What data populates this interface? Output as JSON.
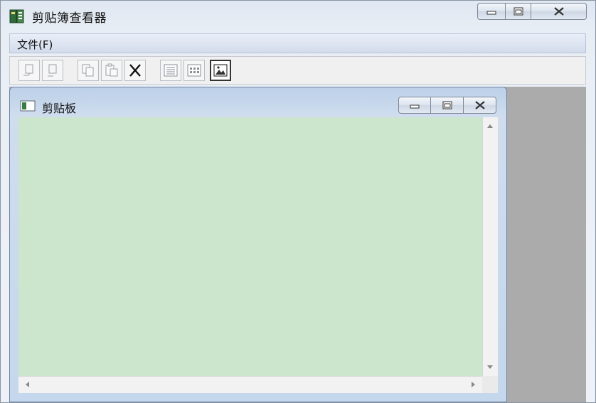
{
  "window": {
    "title": "剪贴簿查看器",
    "icons": {
      "app": "clipbook-icon",
      "minimize": "minimize-icon",
      "maximize": "restore-icon",
      "close": "close-icon"
    }
  },
  "menu": {
    "items": [
      {
        "label": "文件(F)"
      }
    ]
  },
  "toolbar": {
    "buttons": [
      {
        "icon": "share-icon",
        "enabled": false
      },
      {
        "icon": "stop-sharing-icon",
        "enabled": false
      },
      {
        "icon": "copy-icon",
        "enabled": false
      },
      {
        "icon": "paste-icon",
        "enabled": false
      },
      {
        "icon": "delete-icon",
        "enabled": true
      },
      {
        "icon": "table-of-contents-icon",
        "enabled": true
      },
      {
        "icon": "thumbnails-icon",
        "enabled": true
      },
      {
        "icon": "full-page-icon",
        "enabled": true,
        "pressed": true
      }
    ]
  },
  "child_window": {
    "title": "剪贴板",
    "content_color": "#cbe6cc"
  }
}
